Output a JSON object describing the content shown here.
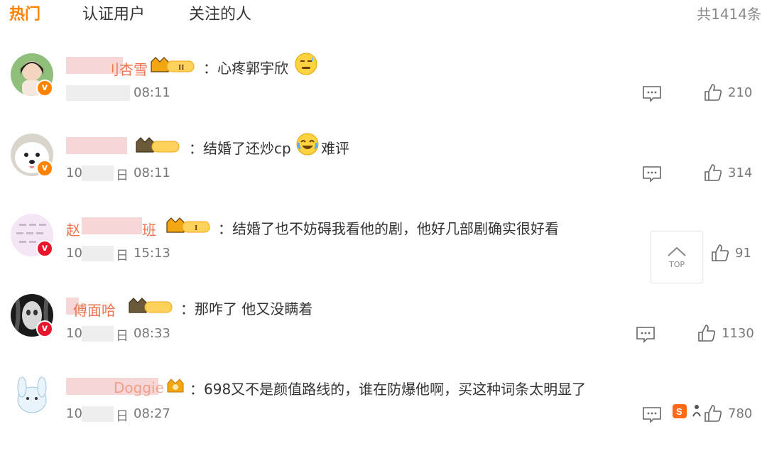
{
  "tabs": [
    {
      "label": "热门"
    },
    {
      "label": "认证用户"
    },
    {
      "label": "关注的人"
    }
  ],
  "total_count": "共1414条",
  "colors": {
    "accent": "#ff8200",
    "username": "#eb7350",
    "verified_orange": "#ff8200",
    "verified_red": "#e6162d"
  },
  "comments": [
    {
      "username": "刂杏雪",
      "vip": "II",
      "text": "：心疼郭宇欣",
      "emoji": "sweat-face-icon",
      "time": "08:11",
      "likes": "210"
    },
    {
      "username": "",
      "vip": "",
      "text": "：结婚了还炒cp",
      "emoji": "laugh-cry-icon",
      "text_after": "难评",
      "time": "08:11",
      "time_prefix": "10",
      "time_suffix": "日",
      "likes": "314"
    },
    {
      "username": "赵",
      "username_tail": "班",
      "vip": "I",
      "text": "：结婚了也不妨碍我看他的剧，他好几部剧确实很好看",
      "time": "15:13",
      "time_prefix": "10",
      "time_suffix": "日",
      "likes": "91"
    },
    {
      "username": "傅面哈",
      "vip": "",
      "text": "：那咋了 他又没瞒着",
      "time": "08:33",
      "time_prefix": "10",
      "time_suffix": "日",
      "likes": "1130"
    },
    {
      "username": "Doggie",
      "vip": "",
      "text": "：698又不是颜值路线的，谁在防爆他啊，买这种词条太明显了",
      "time": "08:27",
      "time_prefix": "10",
      "time_suffix": "日",
      "likes": "780"
    }
  ],
  "top_button": {
    "label": "TOP"
  }
}
